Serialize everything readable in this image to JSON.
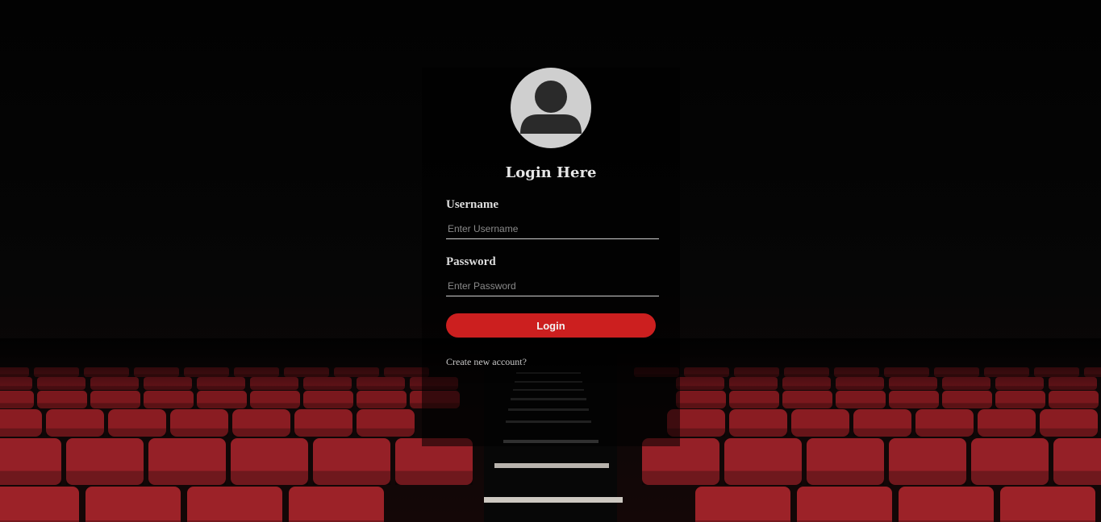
{
  "login": {
    "title": "Login Here",
    "username_label": "Username",
    "username_placeholder": "Enter Username",
    "password_label": "Password",
    "password_placeholder": "Enter Password",
    "button_label": "Login",
    "create_account_link": "Create new account?"
  },
  "theme": {
    "accent": "#cc1f1f",
    "seat_color": "#8e1d22",
    "avatar_bg": "#cfcfcf",
    "avatar_icon": "#2a2a2a"
  },
  "icons": {
    "avatar": "user-silhouette-icon"
  }
}
